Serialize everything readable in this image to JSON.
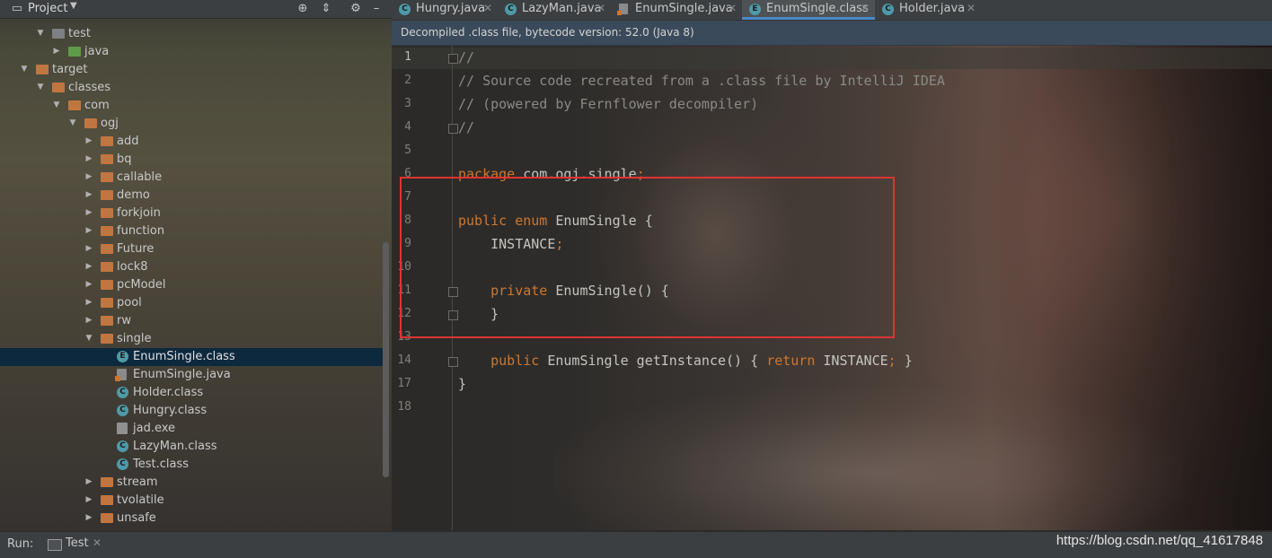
{
  "project_panel": {
    "title": "Project",
    "tree": [
      {
        "label": "test",
        "type": "folder-plain",
        "expanded": true
      },
      {
        "label": "java",
        "type": "folder-green"
      },
      {
        "label": "target",
        "type": "folder-orange",
        "expanded": true
      },
      {
        "label": "classes",
        "type": "folder-orange",
        "expanded": true
      },
      {
        "label": "com",
        "type": "folder-orange",
        "expanded": true
      },
      {
        "label": "ogj",
        "type": "folder-orange",
        "expanded": true
      },
      {
        "label": "add",
        "type": "folder-orange"
      },
      {
        "label": "bq",
        "type": "folder-orange"
      },
      {
        "label": "callable",
        "type": "folder-orange"
      },
      {
        "label": "demo",
        "type": "folder-orange"
      },
      {
        "label": "forkjoin",
        "type": "folder-orange"
      },
      {
        "label": "function",
        "type": "folder-orange"
      },
      {
        "label": "Future",
        "type": "folder-orange"
      },
      {
        "label": "lock8",
        "type": "folder-orange"
      },
      {
        "label": "pcModel",
        "type": "folder-orange"
      },
      {
        "label": "pool",
        "type": "folder-orange"
      },
      {
        "label": "rw",
        "type": "folder-orange"
      },
      {
        "label": "single",
        "type": "folder-orange",
        "expanded": true
      },
      {
        "label": "EnumSingle.class",
        "type": "enum-class",
        "selected": true
      },
      {
        "label": "EnumSingle.java",
        "type": "java-file"
      },
      {
        "label": "Holder.class",
        "type": "class-file"
      },
      {
        "label": "Hungry.class",
        "type": "class-file"
      },
      {
        "label": "jad.exe",
        "type": "exe-file"
      },
      {
        "label": "LazyMan.class",
        "type": "class-file"
      },
      {
        "label": "Test.class",
        "type": "class-file"
      },
      {
        "label": "stream",
        "type": "folder-orange"
      },
      {
        "label": "tvolatile",
        "type": "folder-orange"
      },
      {
        "label": "unsafe",
        "type": "folder-orange"
      }
    ]
  },
  "tabs": [
    {
      "label": "Hungry.java",
      "icon": "class-icon",
      "icon_letter": "C"
    },
    {
      "label": "LazyMan.java",
      "icon": "class-icon",
      "icon_letter": "C"
    },
    {
      "label": "EnumSingle.java",
      "icon": "java-file-icon"
    },
    {
      "label": "EnumSingle.class",
      "icon": "enum-icon",
      "icon_letter": "E",
      "active": true
    },
    {
      "label": "Holder.java",
      "icon": "class-icon",
      "icon_letter": "C"
    }
  ],
  "banner": {
    "text": "Decompiled .class file, bytecode version: 52.0 (Java 8)"
  },
  "editor": {
    "line_numbers": [
      "1",
      "2",
      "3",
      "4",
      "5",
      "6",
      "7",
      "8",
      "9",
      "10",
      "11",
      "12",
      "13",
      "14",
      "17",
      "18"
    ],
    "lines": [
      "//",
      "// Source code recreated from a .class file by IntelliJ IDEA",
      "// (powered by Fernflower decompiler)",
      "//",
      "",
      "package com.ogj.single;",
      "",
      "public enum EnumSingle {",
      "    INSTANCE;",
      "",
      "    private EnumSingle() {",
      "    }",
      "",
      "    public EnumSingle getInstance() { return INSTANCE; }",
      "}",
      ""
    ]
  },
  "bottom_bar": {
    "run_label": "Run:",
    "run_tab": "Test"
  },
  "watermark": "https://blog.csdn.net/qq_41617848",
  "colors": {
    "keyword": "#cc7832",
    "comment": "#8a8a85",
    "highlight_box": "#e03333",
    "selection": "#0d293e",
    "tab_underline": "#4a88c7"
  }
}
